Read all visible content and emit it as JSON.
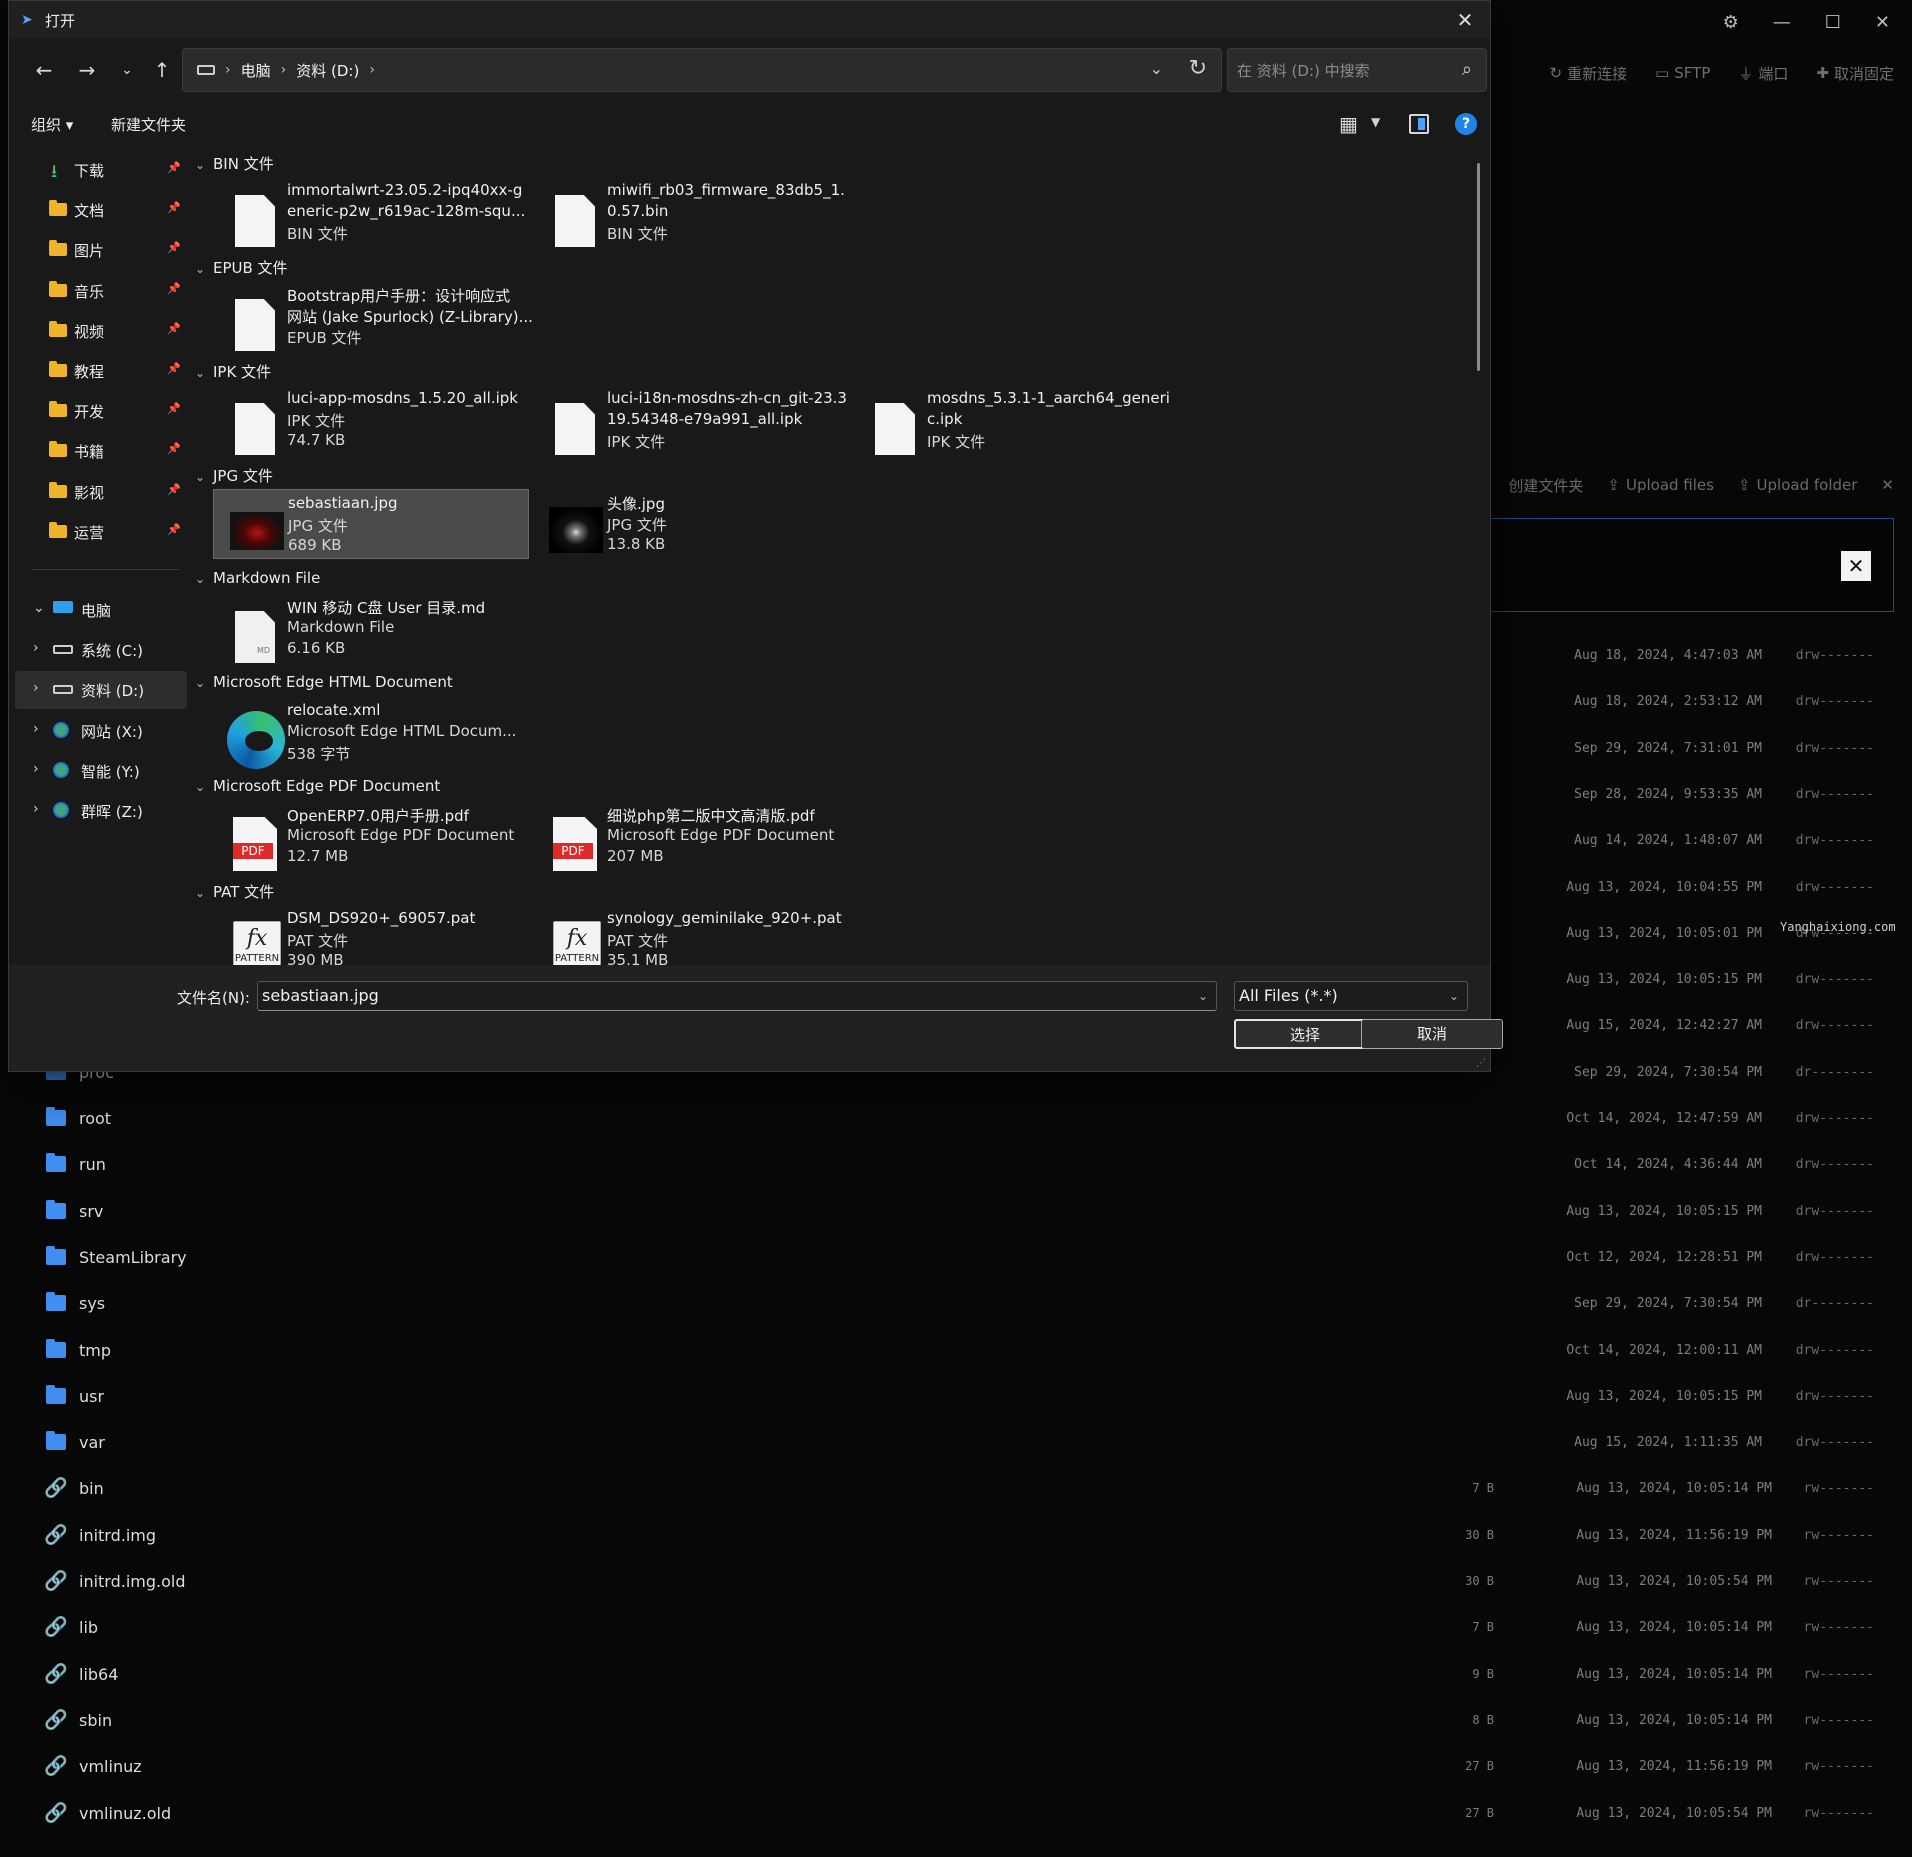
{
  "background": {
    "toolbar": {
      "reconnect": "重新连接",
      "sftp": "SFTP",
      "port": "端口",
      "unpin": "取消固定"
    },
    "upload_bar": {
      "create_folder": "创建文件夹",
      "upload_files": "Upload files",
      "upload_folder": "Upload folder"
    },
    "modal_close": "✕",
    "watermark": "Yanghaixiong.com",
    "rows": [
      {
        "name": "",
        "size": "",
        "date": "Aug 18, 2024, 4:47:03 AM",
        "perm": "drw-------",
        "type": "none"
      },
      {
        "name": "",
        "size": "",
        "date": "Aug 18, 2024, 2:53:12 AM",
        "perm": "drw-------",
        "type": "none"
      },
      {
        "name": "",
        "size": "",
        "date": "Sep 29, 2024, 7:31:01 PM",
        "perm": "drw-------",
        "type": "none"
      },
      {
        "name": "",
        "size": "",
        "date": "Sep 28, 2024, 9:53:35 AM",
        "perm": "drw-------",
        "type": "none"
      },
      {
        "name": "",
        "size": "",
        "date": "Aug 14, 2024, 1:48:07 AM",
        "perm": "drw-------",
        "type": "none"
      },
      {
        "name": "",
        "size": "",
        "date": "Aug 13, 2024, 10:04:55 PM",
        "perm": "drw-------",
        "type": "none"
      },
      {
        "name": "",
        "size": "",
        "date": "Aug 13, 2024, 10:05:01 PM",
        "perm": "drw-------",
        "type": "none"
      },
      {
        "name": "",
        "size": "",
        "date": "Aug 13, 2024, 10:05:15 PM",
        "perm": "drw-------",
        "type": "none"
      },
      {
        "name": "",
        "size": "",
        "date": "Aug 15, 2024, 12:42:27 AM",
        "perm": "drw-------",
        "type": "none"
      },
      {
        "name": "proc",
        "size": "",
        "date": "Sep 29, 2024, 7:30:54 PM",
        "perm": "dr--------",
        "type": "folder"
      },
      {
        "name": "root",
        "size": "",
        "date": "Oct 14, 2024, 12:47:59 AM",
        "perm": "drw-------",
        "type": "folder"
      },
      {
        "name": "run",
        "size": "",
        "date": "Oct 14, 2024, 4:36:44 AM",
        "perm": "drw-------",
        "type": "folder"
      },
      {
        "name": "srv",
        "size": "",
        "date": "Aug 13, 2024, 10:05:15 PM",
        "perm": "drw-------",
        "type": "folder"
      },
      {
        "name": "SteamLibrary",
        "size": "",
        "date": "Oct 12, 2024, 12:28:51 PM",
        "perm": "drw-------",
        "type": "folder"
      },
      {
        "name": "sys",
        "size": "",
        "date": "Sep 29, 2024, 7:30:54 PM",
        "perm": "dr--------",
        "type": "folder"
      },
      {
        "name": "tmp",
        "size": "",
        "date": "Oct 14, 2024, 12:00:11 AM",
        "perm": "drw-------",
        "type": "folder"
      },
      {
        "name": "usr",
        "size": "",
        "date": "Aug 13, 2024, 10:05:15 PM",
        "perm": "drw-------",
        "type": "folder"
      },
      {
        "name": "var",
        "size": "",
        "date": "Aug 15, 2024, 1:11:35 AM",
        "perm": "drw-------",
        "type": "folder"
      },
      {
        "name": "bin",
        "size": "7 B",
        "date": "Aug 13, 2024, 10:05:14 PM",
        "perm": "rw-------",
        "type": "link"
      },
      {
        "name": "initrd.img",
        "size": "30 B",
        "date": "Aug 13, 2024, 11:56:19 PM",
        "perm": "rw-------",
        "type": "link"
      },
      {
        "name": "initrd.img.old",
        "size": "30 B",
        "date": "Aug 13, 2024, 10:05:54 PM",
        "perm": "rw-------",
        "type": "link"
      },
      {
        "name": "lib",
        "size": "7 B",
        "date": "Aug 13, 2024, 10:05:14 PM",
        "perm": "rw-------",
        "type": "link"
      },
      {
        "name": "lib64",
        "size": "9 B",
        "date": "Aug 13, 2024, 10:05:14 PM",
        "perm": "rw-------",
        "type": "link"
      },
      {
        "name": "sbin",
        "size": "8 B",
        "date": "Aug 13, 2024, 10:05:14 PM",
        "perm": "rw-------",
        "type": "link"
      },
      {
        "name": "vmlinuz",
        "size": "27 B",
        "date": "Aug 13, 2024, 11:56:19 PM",
        "perm": "rw-------",
        "type": "link"
      },
      {
        "name": "vmlinuz.old",
        "size": "27 B",
        "date": "Aug 13, 2024, 10:05:54 PM",
        "perm": "rw-------",
        "type": "link"
      }
    ]
  },
  "dialog": {
    "title": "打开",
    "close": "✕",
    "address": {
      "crumbs": [
        "电脑",
        "资料 (D:)"
      ],
      "search_placeholder": "在 资料 (D:) 中搜索"
    },
    "commands": {
      "organize": "组织 ▾",
      "new_folder": "新建文件夹",
      "help": "?"
    },
    "sidebar": {
      "quick": [
        {
          "label": "下载",
          "icon": "download-icon"
        },
        {
          "label": "文档",
          "icon": "folder-icon"
        },
        {
          "label": "图片",
          "icon": "folder-icon"
        },
        {
          "label": "音乐",
          "icon": "folder-icon"
        },
        {
          "label": "视频",
          "icon": "folder-icon"
        },
        {
          "label": "教程",
          "icon": "folder-icon"
        },
        {
          "label": "开发",
          "icon": "folder-icon"
        },
        {
          "label": "书籍",
          "icon": "folder-icon"
        },
        {
          "label": "影视",
          "icon": "folder-icon"
        },
        {
          "label": "运营",
          "icon": "folder-icon"
        }
      ],
      "tree": [
        {
          "label": "电脑",
          "chev": "⌄",
          "icon": "pc"
        },
        {
          "label": "系统 (C:)",
          "chev": "›",
          "icon": "drive"
        },
        {
          "label": "资料 (D:)",
          "chev": "›",
          "icon": "drive",
          "selected": true
        },
        {
          "label": "网站 (X:)",
          "chev": "›",
          "icon": "net"
        },
        {
          "label": "智能 (Y:)",
          "chev": "›",
          "icon": "net"
        },
        {
          "label": "群晖 (Z:)",
          "chev": "›",
          "icon": "net"
        }
      ]
    },
    "groups": [
      {
        "header": "BIN 文件",
        "files": [
          {
            "l1": "immortalwrt-23.05.2-ipq40xx-g",
            "l2": "eneric-p2w_r619ac-128m-squ...",
            "m1": "BIN 文件",
            "m2": "",
            "icon": "doc"
          },
          {
            "l1": "miwifi_rb03_firmware_83db5_1.",
            "l2": "0.57.bin",
            "m1": "BIN 文件",
            "m2": "",
            "icon": "doc"
          }
        ]
      },
      {
        "header": "EPUB 文件",
        "files": [
          {
            "l1": "Bootstrap用户手册：设计响应式",
            "l2": "网站 (Jake Spurlock) (Z-Library)...",
            "m1": "EPUB 文件",
            "m2": "",
            "icon": "doc"
          }
        ]
      },
      {
        "header": "IPK 文件",
        "files": [
          {
            "l1": "luci-app-mosdns_1.5.20_all.ipk",
            "l2": "",
            "m1": "IPK 文件",
            "m2": "74.7 KB",
            "icon": "doc"
          },
          {
            "l1": "luci-i18n-mosdns-zh-cn_git-23.3",
            "l2": "19.54348-e79a991_all.ipk",
            "m1": "IPK 文件",
            "m2": "",
            "icon": "doc"
          },
          {
            "l1": "mosdns_5.3.1-1_aarch64_generi",
            "l2": "c.ipk",
            "m1": "IPK 文件",
            "m2": "",
            "icon": "doc"
          }
        ]
      },
      {
        "header": "JPG 文件",
        "files": [
          {
            "l1": "sebastiaan.jpg",
            "l2": "",
            "m1": "JPG 文件",
            "m2": "689 KB",
            "icon": "img1",
            "selected": true
          },
          {
            "l1": "头像.jpg",
            "l2": "",
            "m1": "JPG 文件",
            "m2": "13.8 KB",
            "icon": "img2"
          }
        ]
      },
      {
        "header": "Markdown File",
        "files": [
          {
            "l1": "WIN 移动 C盘 User 目录.md",
            "l2": "",
            "m1": "Markdown File",
            "m2": "6.16 KB",
            "icon": "md"
          }
        ]
      },
      {
        "header": "Microsoft Edge HTML Document",
        "files": [
          {
            "l1": "relocate.xml",
            "l2": "",
            "m1": "Microsoft Edge HTML Docum...",
            "m2": "538 字节",
            "icon": "edge"
          }
        ]
      },
      {
        "header": "Microsoft Edge PDF Document",
        "files": [
          {
            "l1": "OpenERP7.0用户手册.pdf",
            "l2": "",
            "m1": "Microsoft Edge PDF Document",
            "m2": "12.7 MB",
            "icon": "pdf"
          },
          {
            "l1": "细说php第二版中文高清版.pdf",
            "l2": "",
            "m1": "Microsoft Edge PDF Document",
            "m2": "207 MB",
            "icon": "pdf"
          }
        ]
      },
      {
        "header": "PAT 文件",
        "files": [
          {
            "l1": "DSM_DS920+_69057.pat",
            "l2": "",
            "m1": "PAT 文件",
            "m2": "390 MB",
            "icon": "pat"
          },
          {
            "l1": "synology_geminilake_920+.pat",
            "l2": "",
            "m1": "PAT 文件",
            "m2": "35.1 MB",
            "icon": "pat"
          }
        ]
      }
    ],
    "icon_text": {
      "pdf": "PDF",
      "fx": "fx",
      "pattern": "PATTERN"
    },
    "footer": {
      "filename_label": "文件名(N):",
      "filename_value": "sebastiaan.jpg",
      "filter": "All Files (*.*)",
      "ok": "选择",
      "cancel": "取消"
    }
  }
}
